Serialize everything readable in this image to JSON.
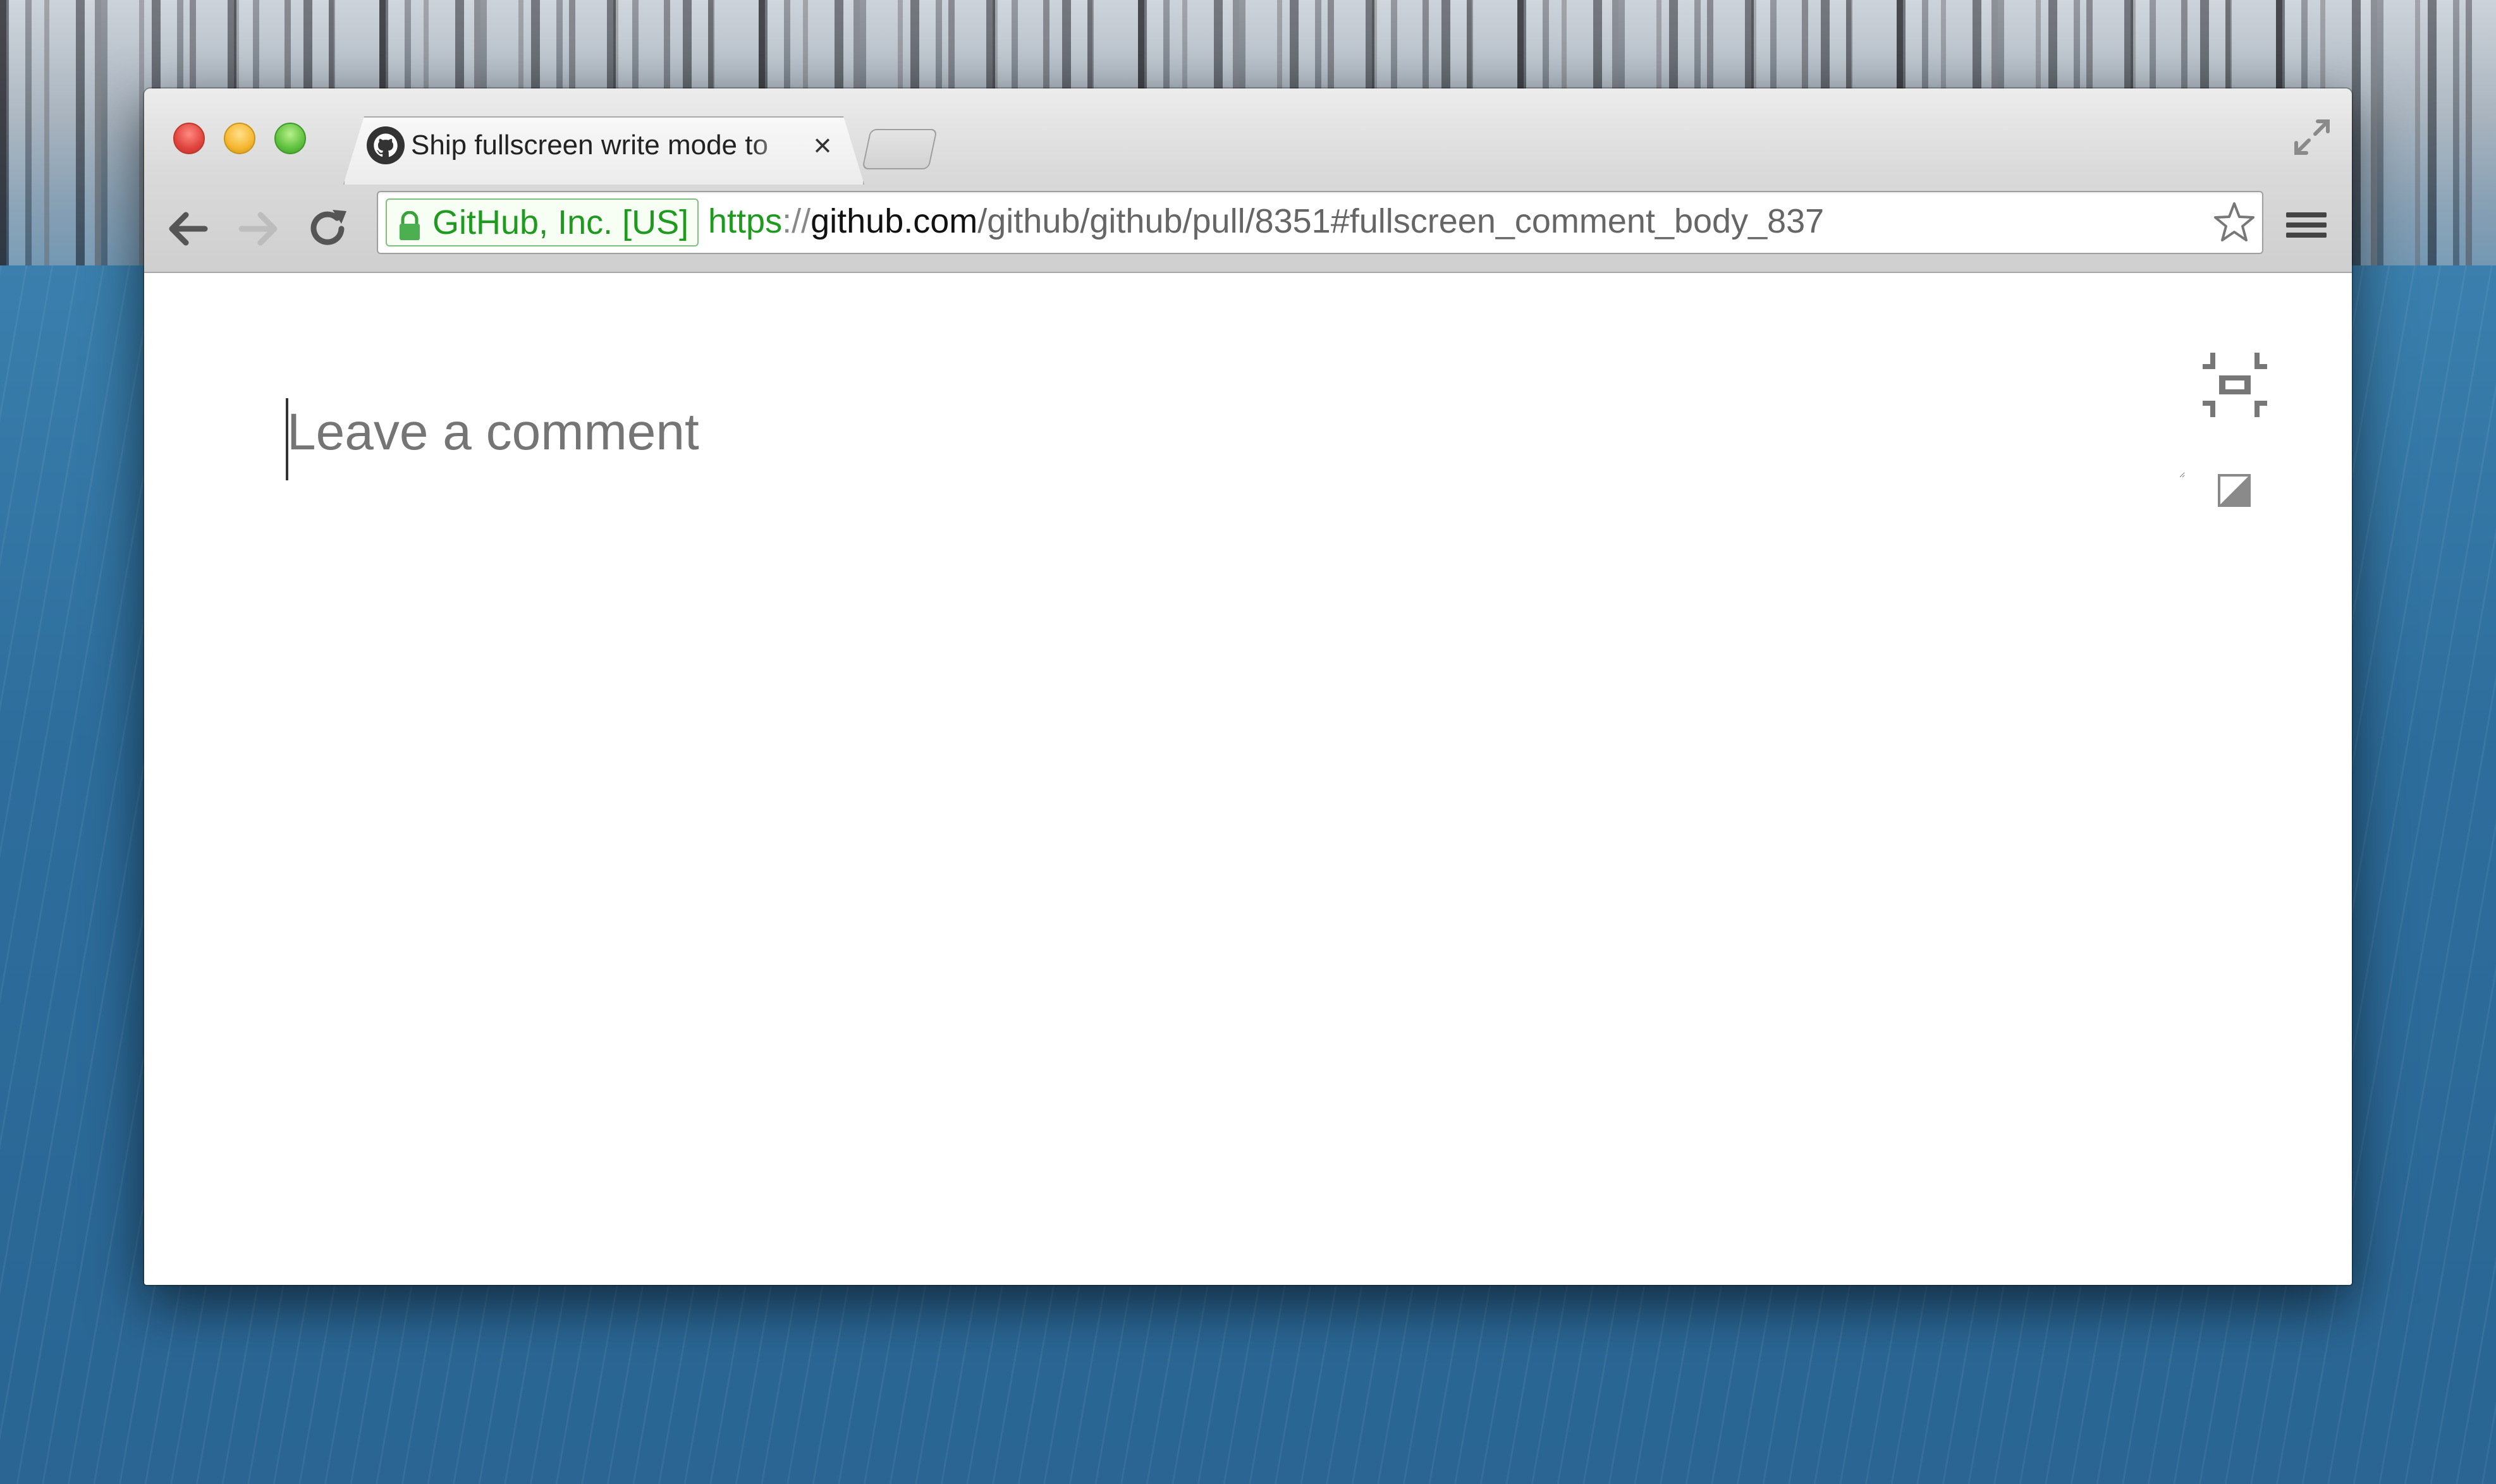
{
  "browser": {
    "tab": {
      "title": "Ship fullscreen write mode to",
      "close_glyph": "×",
      "favicon": "github-octocat-icon"
    },
    "omnibox": {
      "ev_badge": "GitHub, Inc. [US]",
      "url_scheme": "https",
      "url_sep": "://",
      "url_host": "github.com",
      "url_path": "/github/github/pull/8351#fullscreen_comment_body_837"
    },
    "icons": {
      "back": "back-arrow-icon",
      "forward": "forward-arrow-icon",
      "reload": "reload-icon",
      "star": "bookmark-star-icon",
      "menu": "hamburger-menu-icon",
      "fullscreen": "fullscreen-toggle-icon"
    }
  },
  "page": {
    "comment_placeholder": "Leave a comment",
    "icons": {
      "exit_fullscreen": "exit-fullscreen-icon",
      "theme": "contrast-toggle-icon"
    }
  },
  "colors": {
    "ev_green": "#1e9a1e",
    "placeholder": "#bbbbbb"
  }
}
